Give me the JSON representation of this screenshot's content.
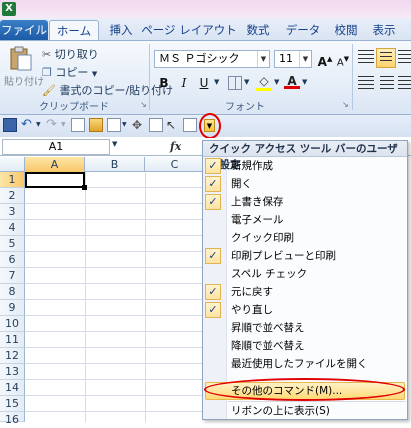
{
  "tabs": {
    "file": "ファイル",
    "home": "ホーム",
    "insert": "挿入",
    "page_layout": "ページ レイアウト",
    "formulas": "数式",
    "data": "データ",
    "review": "校閲",
    "view": "表示"
  },
  "clipboard": {
    "paste": "貼り付け",
    "cut": "切り取り",
    "copy": "コピー",
    "format_painter": "書式のコピー/貼り付け",
    "group_label": "クリップボード"
  },
  "font": {
    "name": "ＭＳ Ｐゴシック",
    "size": "11",
    "group_label": "フォント",
    "bold": "B",
    "italic": "I",
    "underline": "U",
    "grow": "A",
    "shrink": "A"
  },
  "formula_bar": {
    "name_box": "A1",
    "fx": "fx"
  },
  "grid": {
    "columns": [
      "A",
      "B",
      "C"
    ],
    "rows": [
      "1",
      "2",
      "3",
      "4",
      "5",
      "6",
      "7",
      "8",
      "9",
      "10",
      "11",
      "12",
      "13",
      "14",
      "15",
      "16"
    ]
  },
  "menu": {
    "title": "クイック アクセス ツール バーのユーザー設定",
    "items": [
      {
        "label": "新規作成",
        "checked": true
      },
      {
        "label": "開く",
        "checked": true
      },
      {
        "label": "上書き保存",
        "checked": true
      },
      {
        "label": "電子メール",
        "checked": false
      },
      {
        "label": "クイック印刷",
        "checked": false
      },
      {
        "label": "印刷プレビューと印刷",
        "checked": true
      },
      {
        "label": "スペル チェック",
        "checked": false
      },
      {
        "label": "元に戻す",
        "checked": true
      },
      {
        "label": "やり直し",
        "checked": true
      },
      {
        "label": "昇順で並べ替え",
        "checked": false
      },
      {
        "label": "降順で並べ替え",
        "checked": false
      },
      {
        "label": "最近使用したファイルを開く",
        "checked": false
      }
    ],
    "more_commands": "その他のコマンド(M)...",
    "show_below": "リボンの上に表示(S)",
    "check_mark": "✓"
  },
  "accent": {
    "highlight_circle": "#e00000",
    "menu_highlight": "#ffd977"
  }
}
